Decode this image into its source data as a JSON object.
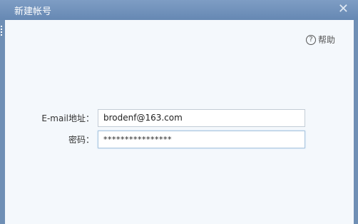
{
  "dialog": {
    "title": "新建帐号",
    "close_label": "✕"
  },
  "help": {
    "icon": "?",
    "label": "帮助"
  },
  "form": {
    "email_label": "E-mail地址：",
    "email_value": "brodenf@163.com",
    "password_label": "密码：",
    "password_value": "****************"
  }
}
